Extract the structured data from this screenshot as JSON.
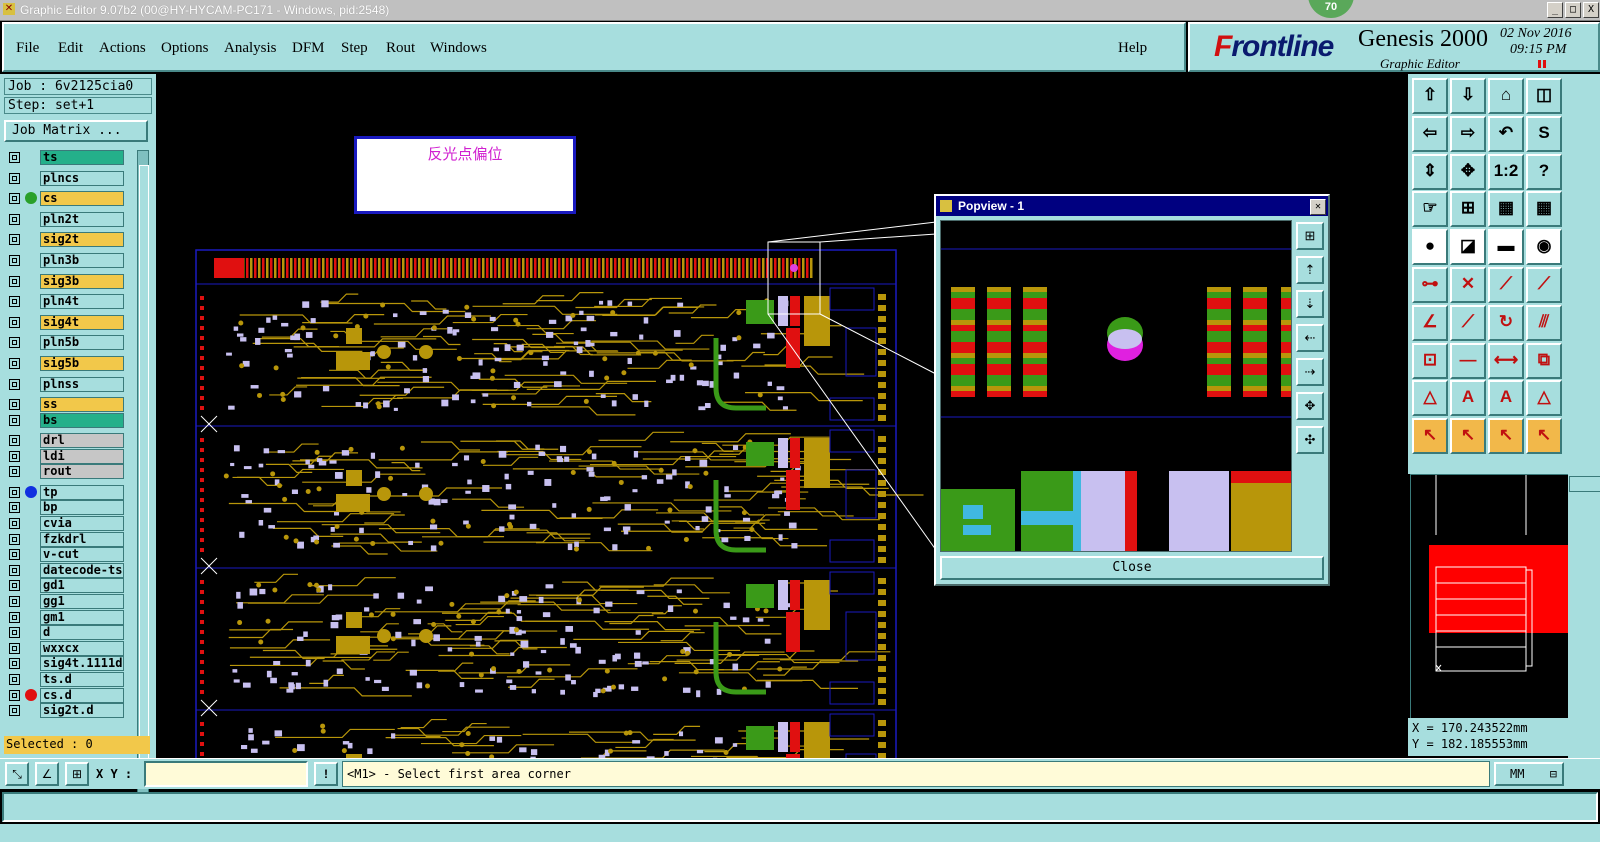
{
  "window": {
    "title": "Graphic Editor 9.07b2 (00@HY-HYCAM-PC171 - Windows, pid:2548)",
    "badge": "70",
    "buttons": [
      "_",
      "□",
      "X"
    ]
  },
  "menu": {
    "items": [
      "File",
      "Edit",
      "Actions",
      "Options",
      "Analysis",
      "DFM",
      "Step",
      "Rout",
      "Windows"
    ],
    "help": "Help"
  },
  "brand": {
    "logo_f": "F",
    "logo_rest": "rontline",
    "product": "Genesis 2000",
    "subtitle": "Graphic Editor",
    "date": "02 Nov 2016",
    "time": "09:15 PM"
  },
  "job": {
    "job_line": "Job : 6v2125cia0",
    "step_line": "Step: set+1",
    "matrix_button": "Job Matrix ..."
  },
  "layers": [
    {
      "name": "ts",
      "kind": "board",
      "dot": ""
    },
    {
      "name": "plncs",
      "kind": "plain",
      "dot": ""
    },
    {
      "name": "cs",
      "kind": "sig",
      "dot": "#2aa02a"
    },
    {
      "name": "pln2t",
      "kind": "plain",
      "dot": ""
    },
    {
      "name": "sig2t",
      "kind": "sig",
      "dot": ""
    },
    {
      "name": "pln3b",
      "kind": "plain",
      "dot": ""
    },
    {
      "name": "sig3b",
      "kind": "sig",
      "dot": ""
    },
    {
      "name": "pln4t",
      "kind": "plain",
      "dot": ""
    },
    {
      "name": "sig4t",
      "kind": "sig",
      "dot": ""
    },
    {
      "name": "pln5b",
      "kind": "plain",
      "dot": ""
    },
    {
      "name": "sig5b",
      "kind": "sig",
      "dot": ""
    },
    {
      "name": "plnss",
      "kind": "plain",
      "dot": ""
    },
    {
      "name": "ss",
      "kind": "sig",
      "dot": ""
    },
    {
      "name": "bs",
      "kind": "board",
      "dot": ""
    },
    {
      "name": "drl",
      "kind": "drill",
      "dot": ""
    },
    {
      "name": "ldi",
      "kind": "drill",
      "dot": ""
    },
    {
      "name": "rout",
      "kind": "drill",
      "dot": ""
    },
    {
      "name": "tp",
      "kind": "plain",
      "dot": "#1030e0"
    },
    {
      "name": "bp",
      "kind": "plain",
      "dot": ""
    },
    {
      "name": "cvia",
      "kind": "plain",
      "dot": ""
    },
    {
      "name": "fzkdrl",
      "kind": "plain",
      "dot": ""
    },
    {
      "name": "v-cut",
      "kind": "plain",
      "dot": ""
    },
    {
      "name": "datecode-ts",
      "kind": "plain",
      "dot": ""
    },
    {
      "name": "gd1",
      "kind": "plain",
      "dot": ""
    },
    {
      "name": "gg1",
      "kind": "plain",
      "dot": ""
    },
    {
      "name": "gm1",
      "kind": "plain",
      "dot": ""
    },
    {
      "name": "d",
      "kind": "plain",
      "dot": ""
    },
    {
      "name": "wxxcx",
      "kind": "plain",
      "dot": ""
    },
    {
      "name": "sig4t.1111d",
      "kind": "plain",
      "dot": ""
    },
    {
      "name": "ts.d",
      "kind": "plain",
      "dot": ""
    },
    {
      "name": "cs.d",
      "kind": "plain",
      "dot": "#e01010"
    },
    {
      "name": "sig2t.d",
      "kind": "plain",
      "dot": ""
    }
  ],
  "selected": "Selected : 0",
  "canvas": {
    "note_text": "反光点偏位"
  },
  "popview": {
    "title": "Popview - 1",
    "close_label": "Close"
  },
  "coords": {
    "x": "X = 170.243522mm",
    "y": "Y = 182.185553mm"
  },
  "bottom": {
    "xy_label": "X Y :",
    "xy_value": "",
    "alert": "!",
    "message": "<M1> - Select first area corner",
    "units": "MM"
  },
  "colors": {
    "panel": "#a7dede",
    "copper": "#b8960a",
    "pad": "#c8c0f0",
    "green": "#3a9a18",
    "red": "#e01010",
    "outline": "#1a1ac0"
  }
}
